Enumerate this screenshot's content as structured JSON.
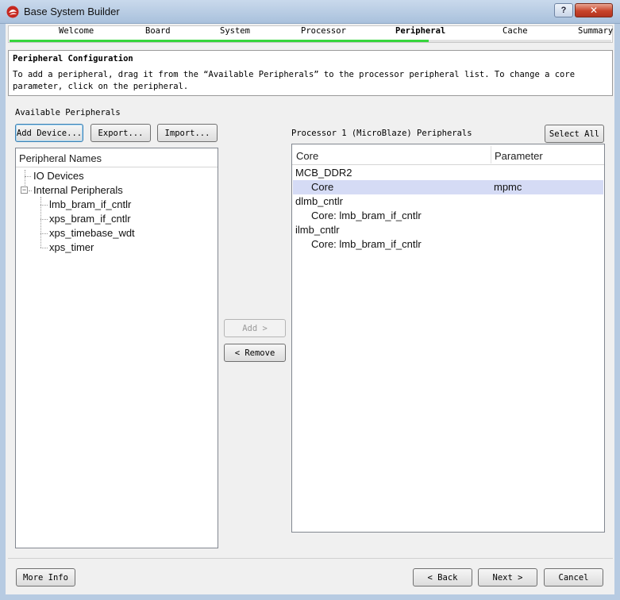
{
  "window": {
    "title": "Base System Builder",
    "help_label": "?",
    "close_label": "✕"
  },
  "steps": [
    {
      "label": "Welcome",
      "active": false
    },
    {
      "label": "Board",
      "active": false
    },
    {
      "label": "System",
      "active": false
    },
    {
      "label": "Processor",
      "active": false
    },
    {
      "label": "Peripheral",
      "active": true
    },
    {
      "label": "Cache",
      "active": false
    },
    {
      "label": "Summary",
      "active": false
    }
  ],
  "header": {
    "title": "Peripheral Configuration",
    "description": "To add a peripheral, drag it from the “Available Peripherals” to the processor peripheral list. To change a core parameter, click on the peripheral."
  },
  "available": {
    "label": "Available Peripherals",
    "add_device": "Add Device...",
    "export": "Export...",
    "import": "Import...",
    "column": "Peripheral Names",
    "tree": {
      "io_devices": "IO Devices",
      "internal": "Internal Peripherals",
      "children": [
        "lmb_bram_if_cntlr",
        "xps_bram_if_cntlr",
        "xps_timebase_wdt",
        "xps_timer"
      ]
    }
  },
  "middle": {
    "add": "Add >",
    "remove": "< Remove"
  },
  "processor": {
    "label": "Processor 1 (MicroBlaze) Peripherals",
    "select_all": "Select All",
    "col_core": "Core",
    "col_param": "Parameter",
    "rows": [
      {
        "core": "MCB_DDR2",
        "param": ""
      },
      {
        "core": "Core",
        "param": "mpmc"
      },
      {
        "core": "dlmb_cntlr",
        "param": ""
      },
      {
        "core": "Core: lmb_bram_if_cntlr",
        "param": ""
      },
      {
        "core": "ilmb_cntlr",
        "param": ""
      },
      {
        "core": "Core: lmb_bram_if_cntlr",
        "param": ""
      }
    ]
  },
  "footer": {
    "more_info": "More Info",
    "back": "< Back",
    "next": "Next >",
    "cancel": "Cancel"
  },
  "colors": {
    "progress": "#37d63d",
    "selection": "#d5dbf5",
    "close": "#c8432a"
  }
}
